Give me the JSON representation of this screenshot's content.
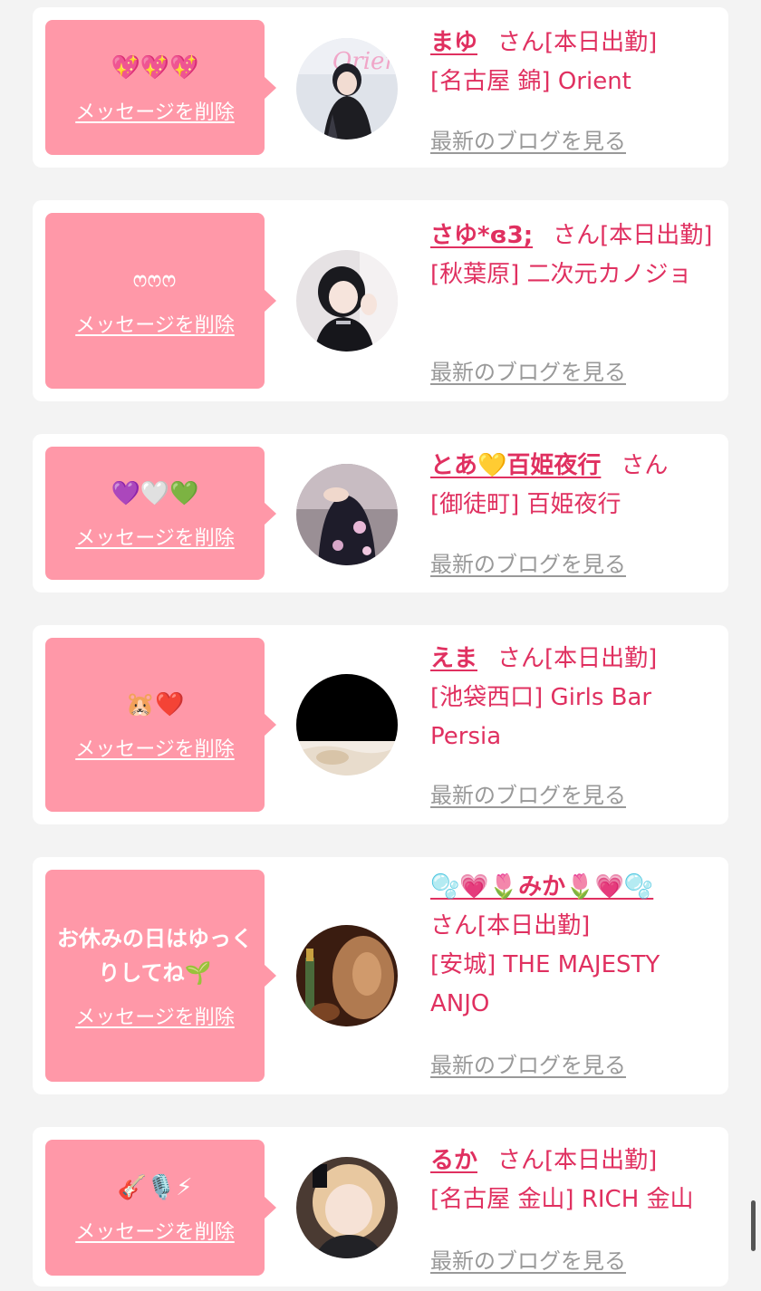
{
  "delete_label": "メッセージを削除",
  "blog_label": "最新のブログを見る",
  "san_label": "さん",
  "cards": [
    {
      "message": "💖💖💖",
      "name": "まゆ",
      "status": "[本日出勤]",
      "shop": "[名古屋 錦] Orient",
      "avatar_desc": "avatar-mayu"
    },
    {
      "message": "ෆෆෆ",
      "name": "さゆ*ɞ3;",
      "status": "[本日出勤]",
      "shop": "[秋葉原] 二次元カノジョ",
      "avatar_desc": "avatar-sayu"
    },
    {
      "message": "💜🤍💚",
      "name": "とあ💛百姫夜行",
      "status": "",
      "shop": "[御徒町] 百姫夜行",
      "avatar_desc": "avatar-toa"
    },
    {
      "message": "🐹❤️",
      "name": "えま",
      "status": "[本日出勤]",
      "shop": "[池袋西口] Girls Bar Persia",
      "avatar_desc": "avatar-ema"
    },
    {
      "message": "お休みの日はゆっくりしてね🌱",
      "name": "🫧💗🌷みか🌷💗🫧",
      "status": "[本日出勤]",
      "shop": "[安城] THE MAJESTY ANJO",
      "avatar_desc": "avatar-mika"
    },
    {
      "message": "🎸🎙️⚡",
      "name": "るか",
      "status": "[本日出勤]",
      "shop": "[名古屋 金山] RICH 金山",
      "avatar_desc": "avatar-ruka"
    }
  ]
}
